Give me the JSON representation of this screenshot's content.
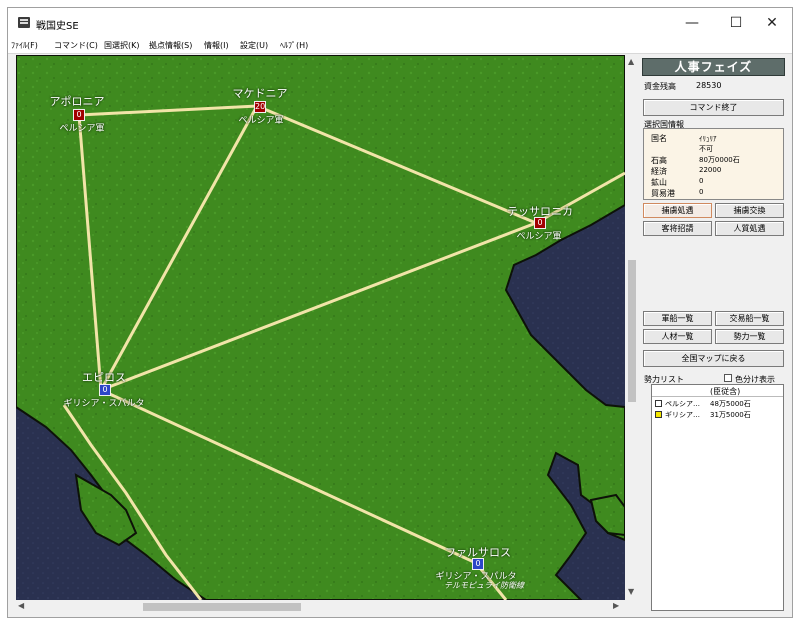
{
  "window": {
    "title": "戦国史SE",
    "minimize_glyph": "—",
    "maximize_glyph": "☐",
    "close_glyph": "✕"
  },
  "menu": [
    "ﾌｧｲﾙ(F)",
    "コマンド(C)",
    "国選択(K)",
    "拠点情報(S)",
    "情報(I)",
    "設定(U)",
    "ﾍﾙﾌﾟ(H)"
  ],
  "map": {
    "colors": {
      "land": "#3f8a1f",
      "sea": "#2a3150",
      "road": "#f1e4a8",
      "red_node": "#a10000",
      "blue_node": "#2d46c8"
    },
    "nodes": [
      {
        "id": "apollonia",
        "name": "アポロニア",
        "value": "0",
        "owner": "ペルシア軍",
        "color": "red"
      },
      {
        "id": "macedonia",
        "name": "マケドニア",
        "value": "20",
        "owner": "ペルシア軍",
        "color": "red"
      },
      {
        "id": "thessalonica",
        "name": "テッサロニカ",
        "value": "0",
        "owner": "ペルシア軍",
        "color": "red"
      },
      {
        "id": "epiros",
        "name": "エピロス",
        "value": "0",
        "owner": "ギリシア・スパルタ",
        "color": "blue"
      },
      {
        "id": "pharsalos",
        "name": "ファルサロス",
        "value": "0",
        "owner": "ギリシア・スパルタ",
        "color": "blue",
        "note": "テルモピュライ防衛線"
      }
    ]
  },
  "panel": {
    "phase_title": "人事フェイズ",
    "funds_label": "資金残高",
    "funds_value": "28530",
    "end_command": "コマンド終了",
    "selected_info_label": "選択国情報",
    "info": [
      {
        "key": "国名",
        "value": "ｲﾘｭﾘｱ"
      },
      {
        "key": "",
        "value": "不可"
      },
      {
        "key": "石高",
        "value": "80万0000石"
      },
      {
        "key": "経済",
        "value": "22000"
      },
      {
        "key": "鉱山",
        "value": "0"
      },
      {
        "key": "貿易港",
        "value": "0"
      }
    ],
    "buttons_row1": [
      "捕虜処遇",
      "捕虜交換"
    ],
    "buttons_row2": [
      "客将招請",
      "人質処遇"
    ],
    "buttons_row3": [
      "軍船一覧",
      "交易船一覧"
    ],
    "buttons_row4": [
      "人材一覧",
      "勢力一覧"
    ],
    "national_map": "全国マップに戻る",
    "force_list_label": "勢力リスト",
    "color_toggle_label": "色分け表示",
    "force_list_header": "(臣従含)",
    "forces": [
      {
        "name": "ペルシア…",
        "value": "48万5000石",
        "color": "#ffffff"
      },
      {
        "name": "ギリシア…",
        "value": "31万5000石",
        "color": "#f3e600"
      }
    ]
  }
}
